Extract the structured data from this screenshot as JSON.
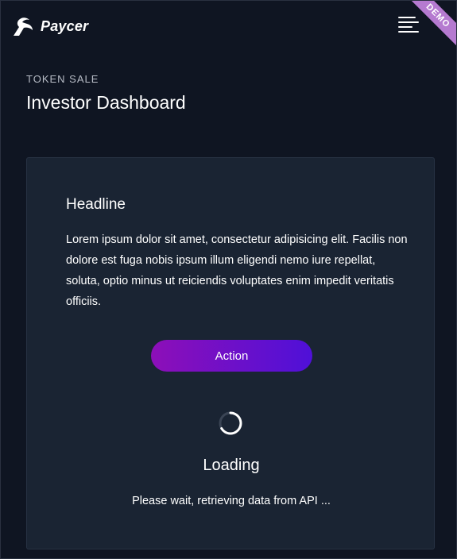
{
  "brand": {
    "name": "Paycer",
    "logo_icon": "paycer-logo-icon"
  },
  "header": {
    "menu_icon": "hamburger-menu-icon",
    "ribbon_label": "DEMO"
  },
  "page": {
    "eyebrow": "TOKEN SALE",
    "title": "Investor Dashboard"
  },
  "card": {
    "headline": "Headline",
    "body": "Lorem ipsum dolor sit amet, consectetur adipisicing elit. Facilis non dolore est fuga nobis ipsum illum eligendi nemo iure repellat, soluta, optio minus ut reiciendis voluptates enim impedit veritatis officiis.",
    "action_label": "Action",
    "loading_title": "Loading",
    "loading_text": "Please wait, retrieving data from API ..."
  },
  "colors": {
    "background": "#0f1522",
    "card": "#1a2433",
    "button_gradient_start": "#8d0fb8",
    "button_gradient_end": "#4f10d8",
    "ribbon": "#b57ad0"
  }
}
